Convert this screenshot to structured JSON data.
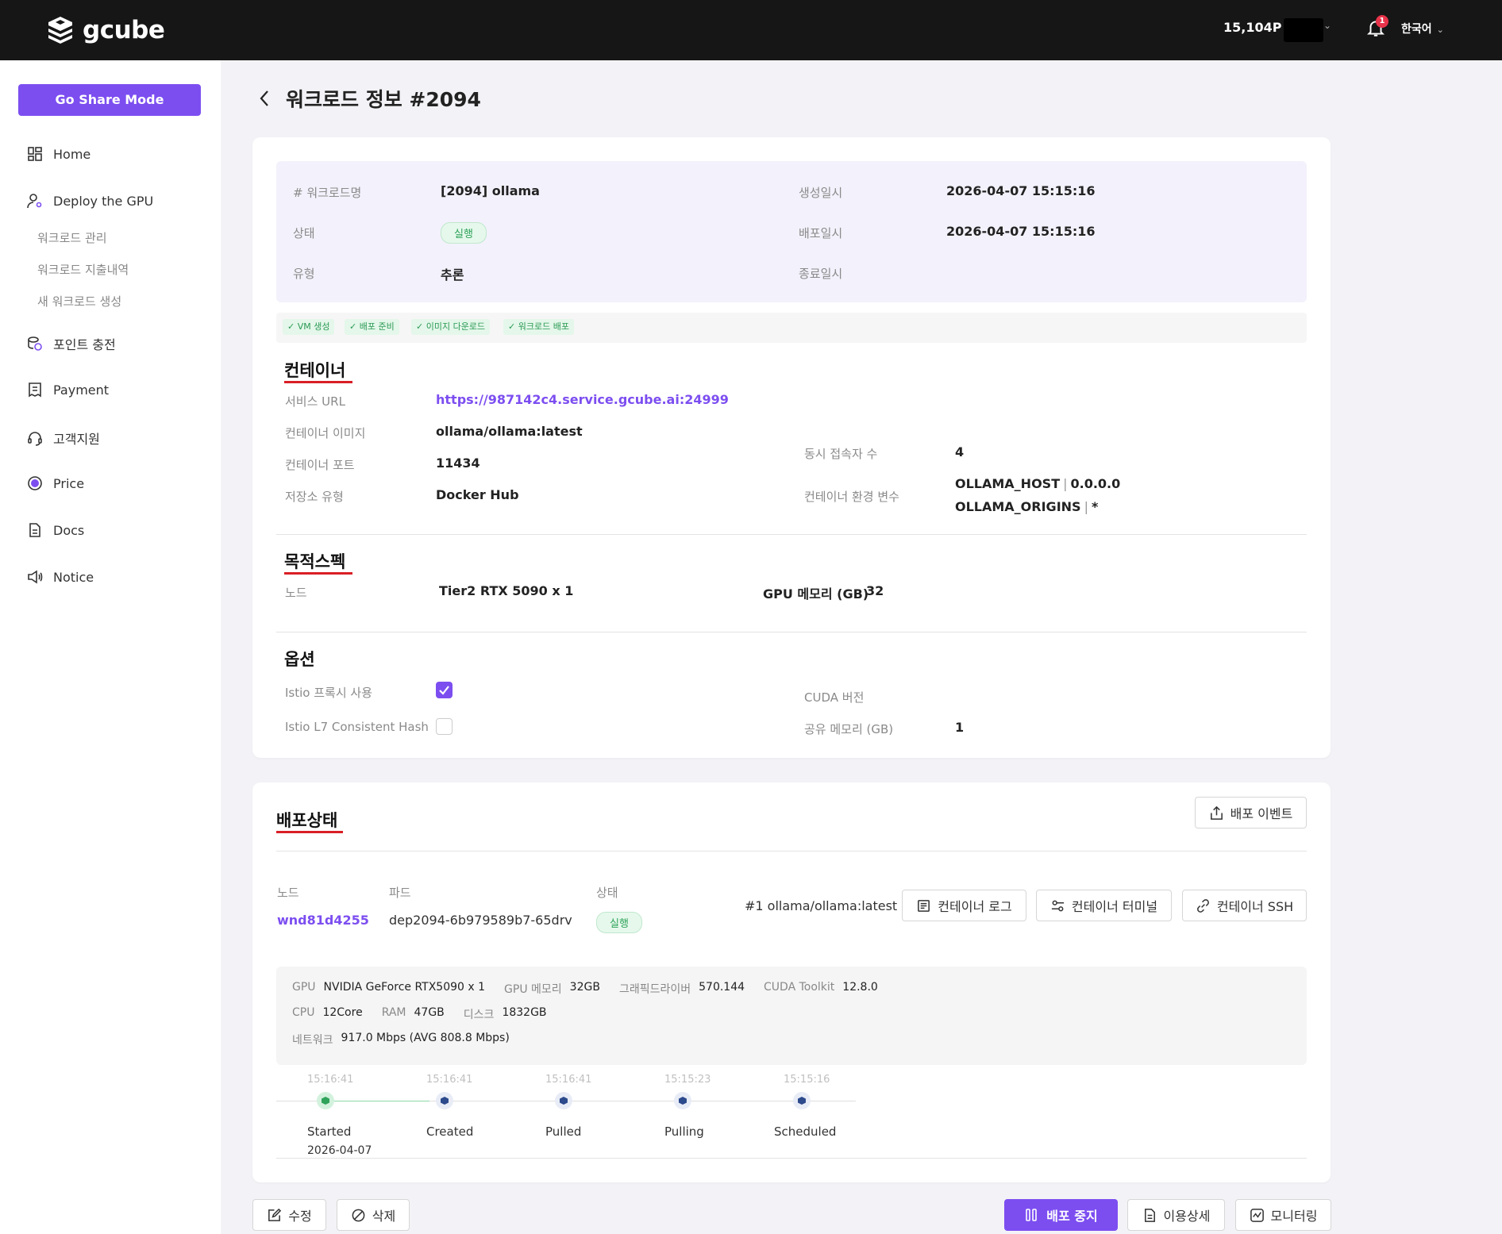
{
  "header": {
    "logo_text": "gcube",
    "points": "15,104P",
    "notification_count": "1",
    "language": "한국어"
  },
  "sidebar": {
    "share_mode_label": "Go Share Mode",
    "items": [
      {
        "label": "Home",
        "icon": "dashboard-icon"
      },
      {
        "label": "Deploy the GPU",
        "icon": "user-gear-icon"
      },
      {
        "label": "포인트 충전",
        "icon": "coins-icon"
      },
      {
        "label": "Payment",
        "icon": "receipt-icon"
      },
      {
        "label": "고객지원",
        "icon": "headset-icon"
      },
      {
        "label": "Price",
        "icon": "dollar-circle-icon"
      },
      {
        "label": "Docs",
        "icon": "document-icon"
      },
      {
        "label": "Notice",
        "icon": "megaphone-icon"
      }
    ],
    "sub_items": [
      "워크로드 관리",
      "워크로드 지출내역",
      "새 워크로드 생성"
    ]
  },
  "page": {
    "title": "워크로드 정보 #2094"
  },
  "info": {
    "name_label": "# 워크로드명",
    "name_value": "[2094] ollama",
    "status_label": "상태",
    "status_value": "실행",
    "type_label": "유형",
    "type_value": "추론",
    "created_label": "생성일시",
    "created_value": "2026-04-07 15:15:16",
    "deployed_label": "배포일시",
    "deployed_value": "2026-04-07 15:15:16",
    "ended_label": "종료일시",
    "ended_value": ""
  },
  "progress_steps": [
    "VM 생성",
    "배포 준비",
    "이미지 다운로드",
    "워크로드 배포"
  ],
  "container": {
    "title": "컨테이너",
    "service_url_label": "서비스 URL",
    "service_url": "https://987142c4.service.gcube.ai:24999",
    "image_label": "컨테이너 이미지",
    "image_value": "ollama/ollama:latest",
    "port_label": "컨테이너 포트",
    "port_value": "11434",
    "storage_label": "저장소 유형",
    "storage_value": "Docker Hub",
    "concurrent_label": "동시 접속자 수",
    "concurrent_value": "4",
    "env_label": "컨테이너 환경 변수",
    "env": [
      {
        "key": "OLLAMA_HOST",
        "value": "0.0.0.0"
      },
      {
        "key": "OLLAMA_ORIGINS",
        "value": "*"
      }
    ]
  },
  "spec": {
    "title": "목적스펙",
    "node_label": "노드",
    "node_value": "Tier2 RTX 5090 x 1",
    "gpu_mem_label": "GPU 메모리 (GB)",
    "gpu_mem_value": "32"
  },
  "options": {
    "title": "옵션",
    "istio_proxy_label": "Istio 프록시 사용",
    "istio_proxy_checked": true,
    "istio_hash_label": "Istio L7 Consistent Hash",
    "istio_hash_checked": false,
    "cuda_label": "CUDA 버전",
    "cuda_value": "",
    "shared_mem_label": "공유 메모리 (GB)",
    "shared_mem_value": "1"
  },
  "deploy": {
    "title": "배포상태",
    "events_button": "배포 이벤트",
    "node_header": "노드",
    "pod_header": "파드",
    "status_header": "상태",
    "node_value": "wnd81d4255",
    "pod_value": "dep2094-6b979589b7-65drv",
    "status_value": "실행",
    "image_tag": "#1 ollama/ollama:latest",
    "log_button": "컨테이너 로그",
    "terminal_button": "컨테이너 터미널",
    "ssh_button": "컨테이너 SSH",
    "hw": {
      "gpu_label": "GPU",
      "gpu_value": "NVIDIA GeForce RTX5090 x 1",
      "gpu_mem_label": "GPU 메모리",
      "gpu_mem_value": "32GB",
      "driver_label": "그래픽드라이버",
      "driver_value": "570.144",
      "cuda_label": "CUDA Toolkit",
      "cuda_value": "12.8.0",
      "cpu_label": "CPU",
      "cpu_value": "12Core",
      "ram_label": "RAM",
      "ram_value": "47GB",
      "disk_label": "디스크",
      "disk_value": "1832GB",
      "net_label": "네트워크",
      "net_value": "917.0 Mbps (AVG 808.8 Mbps)"
    },
    "timeline": [
      {
        "time": "15:16:41",
        "label": "Started",
        "date": "2026-04-07",
        "active": true
      },
      {
        "time": "15:16:41",
        "label": "Created",
        "date": "",
        "active": false
      },
      {
        "time": "15:16:41",
        "label": "Pulled",
        "date": "",
        "active": false
      },
      {
        "time": "15:15:23",
        "label": "Pulling",
        "date": "",
        "active": false
      },
      {
        "time": "15:15:16",
        "label": "Scheduled",
        "date": "",
        "active": false
      }
    ]
  },
  "footer": {
    "edit_button": "수정",
    "delete_button": "삭제",
    "stop_button": "배포 중지",
    "usage_button": "이용상세",
    "monitor_button": "모니터링"
  },
  "colors": {
    "accent": "#7c4ef0",
    "header_bg": "#161616",
    "running_green": "#2fa35a",
    "section_underline": "#d91f26"
  }
}
